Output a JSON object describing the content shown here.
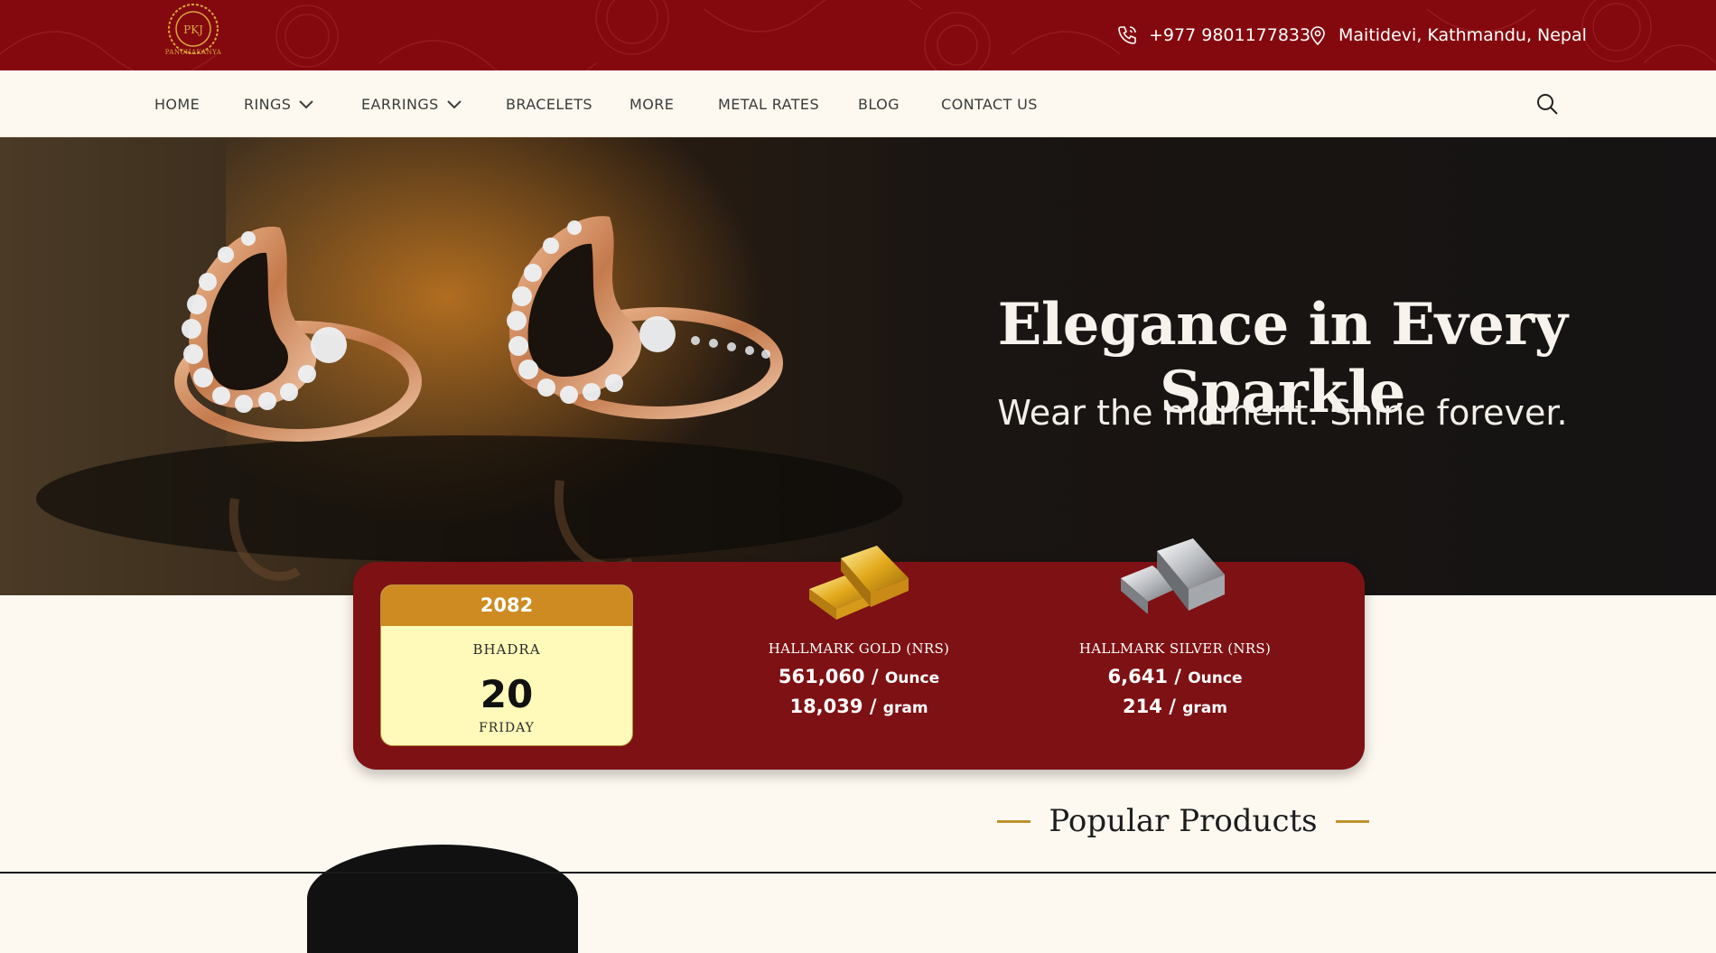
{
  "brand": {
    "logo_monogram": "PKJ",
    "logo_caption": "PANCHAKANYA"
  },
  "topbar": {
    "phone": "+977 9801177833",
    "address": "Maitidevi, Kathmandu, Nepal",
    "phone_icon": "phone-icon",
    "address_icon": "map-pin-icon",
    "background_color": "#84090e"
  },
  "nav": {
    "items": [
      {
        "label": "HOME",
        "has_dropdown": false
      },
      {
        "label": "RINGS",
        "has_dropdown": true
      },
      {
        "label": "EARRINGS",
        "has_dropdown": true
      },
      {
        "label": "BRACELETS",
        "has_dropdown": false
      },
      {
        "label": "MORE",
        "has_dropdown": false
      },
      {
        "label": "METAL RATES",
        "has_dropdown": false
      },
      {
        "label": "BLOG",
        "has_dropdown": false
      },
      {
        "label": "CONTACT US",
        "has_dropdown": false
      }
    ],
    "search_icon": "search-icon"
  },
  "hero": {
    "title": "Elegance in Every Sparkle",
    "subtitle": "Wear the moment. Shine forever."
  },
  "rates": {
    "date": {
      "year": "2082",
      "month": "BHADRA",
      "day": "20",
      "weekday": "FRIDAY"
    },
    "gold": {
      "label": "HALLMARK GOLD (NRS)",
      "per_ounce": "561,060",
      "per_gram": "18,039",
      "unit_ounce": "Ounce",
      "unit_gram": "gram",
      "separator": "/"
    },
    "silver": {
      "label": "HALLMARK SILVER (NRS)",
      "per_ounce": "6,641",
      "per_gram": "214",
      "unit_ounce": "Ounce",
      "unit_gram": "gram",
      "separator": "/"
    },
    "card_color": "#7e1114",
    "accent_color": "#cd8b21"
  },
  "popular": {
    "title": "Popular Products"
  }
}
